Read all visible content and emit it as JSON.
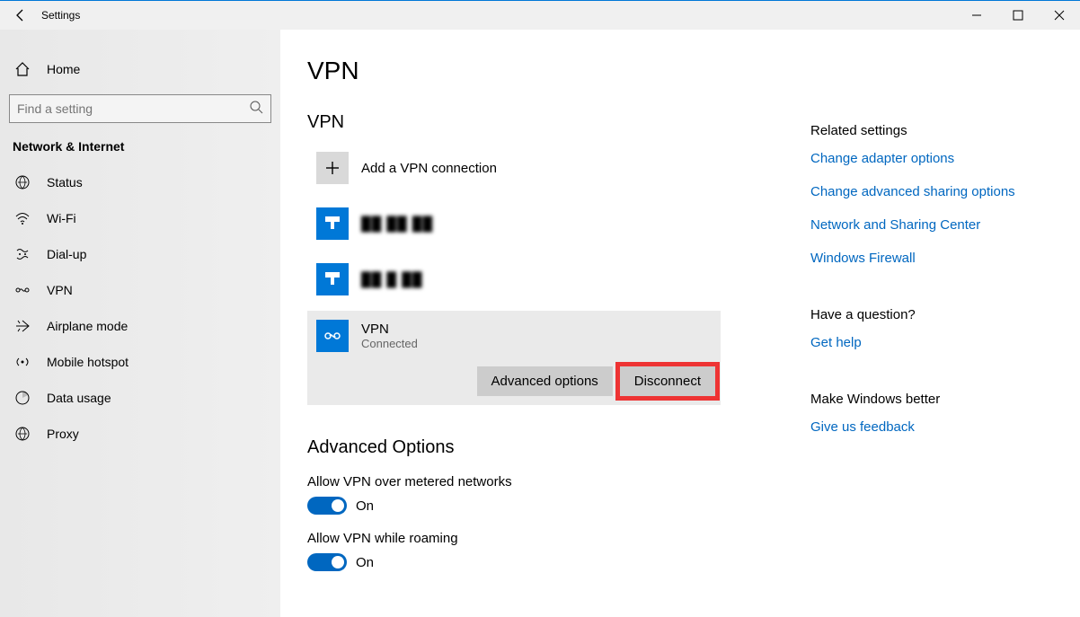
{
  "window": {
    "title": "Settings"
  },
  "sidebar": {
    "home": "Home",
    "search_placeholder": "Find a setting",
    "category": "Network & Internet",
    "items": [
      {
        "icon": "status-icon",
        "label": "Status"
      },
      {
        "icon": "wifi-icon",
        "label": "Wi-Fi"
      },
      {
        "icon": "dialup-icon",
        "label": "Dial-up"
      },
      {
        "icon": "vpn-icon",
        "label": "VPN"
      },
      {
        "icon": "airplane-icon",
        "label": "Airplane mode"
      },
      {
        "icon": "hotspot-icon",
        "label": "Mobile hotspot"
      },
      {
        "icon": "datausage-icon",
        "label": "Data usage"
      },
      {
        "icon": "proxy-icon",
        "label": "Proxy"
      }
    ]
  },
  "main": {
    "page_title": "VPN",
    "section_vpn": "VPN",
    "add_vpn": "Add a VPN connection",
    "connections": [
      {
        "name": "██ ██ ██"
      },
      {
        "name": "██ █ ██"
      }
    ],
    "selected_vpn": {
      "name": "VPN",
      "status": "Connected"
    },
    "btn_advanced": "Advanced options",
    "btn_disconnect": "Disconnect",
    "section_adv": "Advanced Options",
    "opt_metered": {
      "label": "Allow VPN over metered networks",
      "state": "On"
    },
    "opt_roaming": {
      "label": "Allow VPN while roaming",
      "state": "On"
    }
  },
  "right": {
    "related_head": "Related settings",
    "links": [
      "Change adapter options",
      "Change advanced sharing options",
      "Network and Sharing Center",
      "Windows Firewall"
    ],
    "question_head": "Have a question?",
    "get_help": "Get help",
    "better_head": "Make Windows better",
    "feedback": "Give us feedback"
  }
}
